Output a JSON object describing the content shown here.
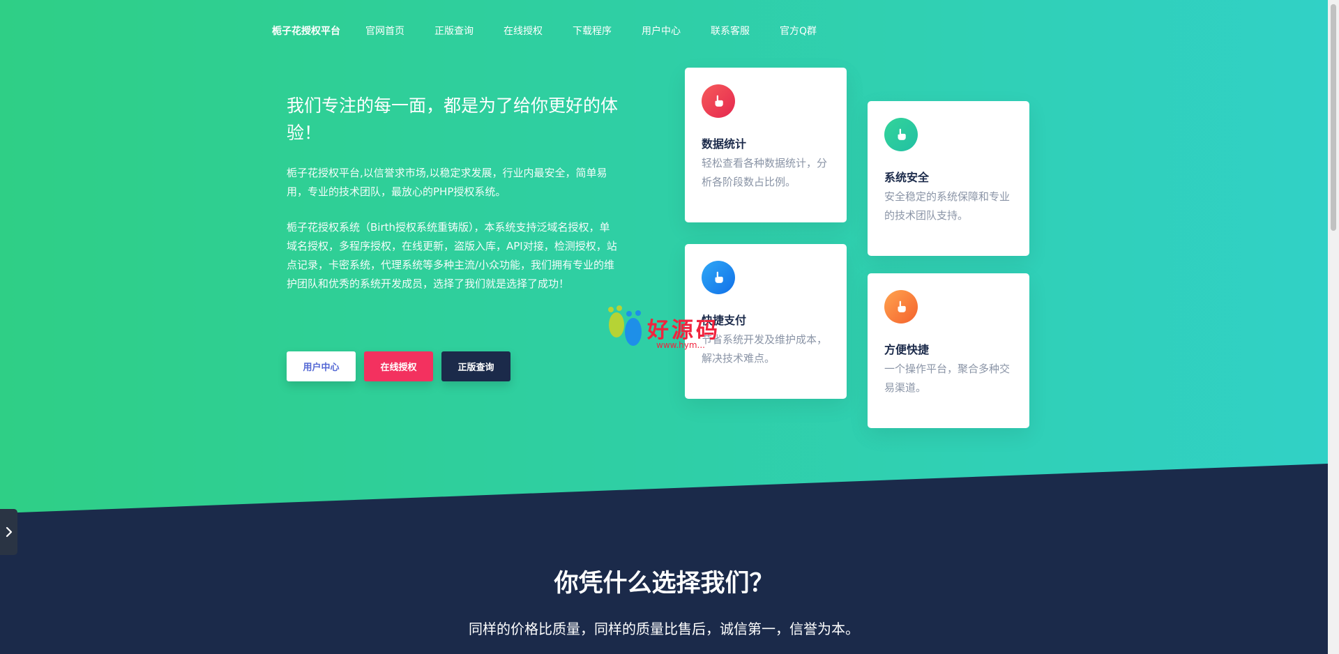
{
  "nav": {
    "brand": "栀子花授权平台",
    "items": [
      "官网首页",
      "正版查询",
      "在线授权",
      "下载程序",
      "用户中心",
      "联系客服",
      "官方Q群"
    ]
  },
  "hero": {
    "headline": "我们专注的每一面，都是为了给你更好的体验！",
    "para1": "栀子花授权平台,以信誉求市场,以稳定求发展，行业内最安全，简单易用，专业的技术团队，最放心的PHP授权系统。",
    "para2": "栀子花授权系统（Birth授权系统重铸版），本系统支持泛域名授权，单域名授权，多程序授权，在线更新，盗版入库，API对接，检测授权，站点记录，卡密系统，代理系统等多种主流/小众功能，我们拥有专业的维护团队和优秀的系统开发成员，选择了我们就是选择了成功！",
    "buttons": {
      "user_center": "用户中心",
      "online_auth": "在线授权",
      "genuine_query": "正版查询"
    }
  },
  "features": [
    {
      "title": "数据统计",
      "desc": "轻松查看各种数据统计，分析各阶段数占比例。",
      "icon": "thumb-up-icon",
      "color": "#ee3b55"
    },
    {
      "title": "系统安全",
      "desc": "安全稳定的系统保障和专业的技术团队支持。",
      "icon": "thumb-up-icon",
      "color": "#2bcba0"
    },
    {
      "title": "快捷支付",
      "desc": "节省系统开发及维护成本，解决技术难点。",
      "icon": "thumb-up-icon",
      "color": "#1e8cf0"
    },
    {
      "title": "方便快捷",
      "desc": "一个操作平台，聚合多种交易渠道。",
      "icon": "thumb-up-icon",
      "color": "#f87d3c"
    }
  ],
  "section": {
    "title": "你凭什么选择我们？",
    "subtitle": "同样的价格比质量，同样的质量比售后，诚信第一，信誉为本。"
  },
  "watermark": {
    "text": "好源码",
    "url": "www.hym..."
  },
  "colors": {
    "hero_start": "#2fcf86",
    "hero_end": "#31d1c6",
    "navy": "#1b2a4a",
    "red_button": "#f3315f"
  }
}
